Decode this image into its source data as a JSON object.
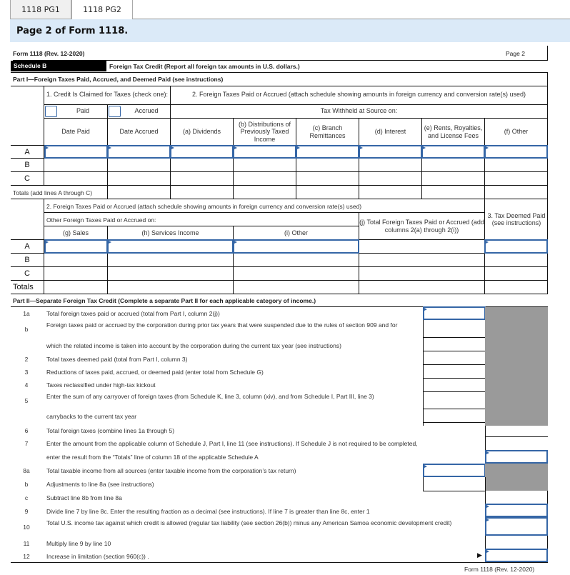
{
  "tabs": [
    {
      "label": "1118 PG1",
      "active": false
    },
    {
      "label": "1118 PG2",
      "active": true
    }
  ],
  "banner_title": "Page 2 of Form 1118.",
  "form": {
    "form_id": "Form 1118 (Rev. 12-2020)",
    "page_label": "Page 2",
    "schedule_label": "Schedule B",
    "schedule_title": "Foreign Tax Credit (Report all foreign tax amounts in U.S. dollars.)",
    "footer": "Form 1118 (Rev. 12-2020)"
  },
  "part1": {
    "title": "Part I—Foreign Taxes Paid, Accrued, and Deemed Paid (see instructions)",
    "col1_header": "1. Credit Is Claimed for Taxes (check one):",
    "paid_label": "Paid",
    "accrued_label": "Accrued",
    "col2_header": "2. Foreign Taxes Paid or Accrued (attach schedule showing amounts in foreign currency and conversion rate(s) used)",
    "withheld_header": "Tax Withheld at Source on:",
    "columns": [
      "Date Paid",
      "Date Accrued",
      "(a) Dividends",
      "(b) Distributions of Previously Taxed Income",
      "(c) Branch Remittances",
      "(d) Interest",
      "(e) Rents, Royalties, and License Fees",
      "(f) Other"
    ],
    "rows": [
      "A",
      "B",
      "C"
    ],
    "totals_label": "Totals (add lines A through C)",
    "col2b_header": "2. Foreign Taxes Paid or Accrued (attach schedule showing amounts in foreign currency and conversion rate(s) used)",
    "other_header": "Other Foreign Taxes Paid or Accrued on:",
    "columns2": [
      "(g) Sales",
      "(h) Services Income",
      "(i) Other"
    ],
    "col_j": "(j) Total Foreign Taxes Paid or Accrued (add columns 2(a) through 2(i))",
    "col3": "3. Tax Deemed Paid (see instructions)",
    "rows2": [
      "A",
      "B",
      "C"
    ],
    "totals2_label": "Totals"
  },
  "part2": {
    "title": "Part II—Separate Foreign Tax Credit (Complete a separate Part II for each applicable category of income.)",
    "lines": [
      {
        "no": "1a",
        "text": "Total foreign taxes paid or accrued (total from Part I, column 2(j))"
      },
      {
        "no": "b",
        "text": "Foreign taxes paid or accrued by the corporation during prior tax years that were suspended due to the rules of section 909 and for"
      },
      {
        "no": "",
        "text": "which the related income is taken into account by the corporation during the current tax year (see instructions)"
      },
      {
        "no": "2",
        "text": "Total taxes deemed paid (total from Part I, column 3)"
      },
      {
        "no": "3",
        "text": "Reductions of taxes paid, accrued, or deemed paid (enter total from Schedule G)"
      },
      {
        "no": "4",
        "text": "Taxes reclassified under high-tax kickout"
      },
      {
        "no": "5",
        "text": "Enter the sum of any carryover of foreign taxes (from Schedule K, line 3, column (xiv), and from Schedule I, Part III, line 3)"
      },
      {
        "no": "",
        "text": "carrybacks to the current tax year"
      },
      {
        "no": "6",
        "text": "Total foreign taxes (combine lines 1a through 5)"
      },
      {
        "no": "7",
        "text": "Enter the amount from the applicable column of Schedule J, Part I, line 11 (see instructions). If Schedule J is not required to be completed,"
      },
      {
        "no": "",
        "text": "enter the result from the “Totals” line of column 18 of the applicable Schedule A"
      },
      {
        "no": "8a",
        "text": "Total taxable income from all sources (enter taxable income from the corporation’s tax return)"
      },
      {
        "no": "b",
        "text": "Adjustments to line 8a (see instructions)"
      },
      {
        "no": "c",
        "text": "Subtract line 8b from line 8a"
      },
      {
        "no": "9",
        "text": "Divide line 7 by line 8c. Enter the resulting fraction as a decimal (see instructions). If line 7 is greater than line 8c, enter 1"
      },
      {
        "no": "10",
        "text": "Total U.S. income tax against which credit is allowed (regular tax liability (see section 26(b)) minus any American Samoa economic development credit)"
      },
      {
        "no": "11",
        "text": "Multiply line 9 by line 10"
      },
      {
        "no": "12",
        "text": "Increase in limitation (section 960(c)) ."
      }
    ],
    "arrow_icon": "▶"
  }
}
